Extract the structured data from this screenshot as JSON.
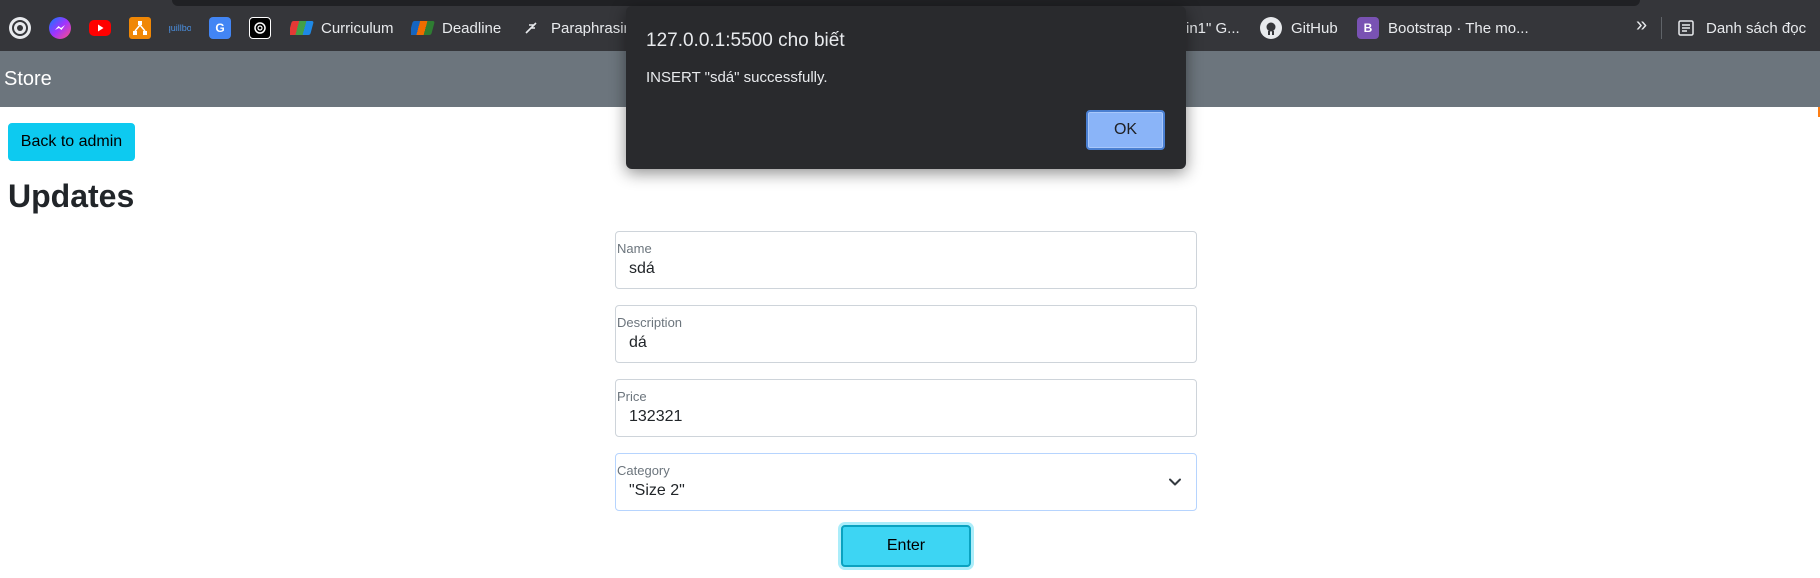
{
  "bookmarks": {
    "items": [
      {
        "icon": "reader-icon",
        "label": ""
      },
      {
        "icon": "messenger-icon",
        "label": ""
      },
      {
        "icon": "youtube-icon",
        "label": ""
      },
      {
        "icon": "diagram-icon",
        "label": ""
      },
      {
        "icon": "quillbot-icon",
        "label": ""
      },
      {
        "icon": "translate-icon",
        "label": ""
      },
      {
        "icon": "chatgpt-icon",
        "label": ""
      },
      {
        "icon": "curriculum-icon",
        "label": "Curriculum"
      },
      {
        "icon": "fpt-icon",
        "label": "Deadline"
      },
      {
        "icon": "feather-icon",
        "label": "Paraphrasin"
      },
      {
        "icon": "",
        "label": "in1\" G..."
      },
      {
        "icon": "github-icon",
        "label": "GitHub"
      },
      {
        "icon": "bootstrap-icon",
        "label": "Bootstrap · The mo..."
      }
    ],
    "overflow_label": "»",
    "reading_list_label": "Danh sách đọc"
  },
  "navbar": {
    "brand": "Store"
  },
  "back_button": "Back to admin",
  "page_title": "Updates",
  "form": {
    "name": {
      "label": "Name",
      "value": "sdá"
    },
    "description": {
      "label": "Description",
      "value": "dá"
    },
    "price": {
      "label": "Price",
      "value": "132321"
    },
    "category": {
      "label": "Category",
      "value": "\"Size 2\""
    },
    "submit": "Enter"
  },
  "dialog": {
    "origin": "127.0.0.1:5500 cho biết",
    "message": "INSERT \"sdá\" successfully.",
    "ok_label": "OK"
  },
  "colors": {
    "bookmarks_bg": "#35363a",
    "navbar_bg": "#6c757d",
    "info": "#0dcaf0",
    "dialog_bg": "#292a2d",
    "dialog_button": "#8ab4f8"
  }
}
